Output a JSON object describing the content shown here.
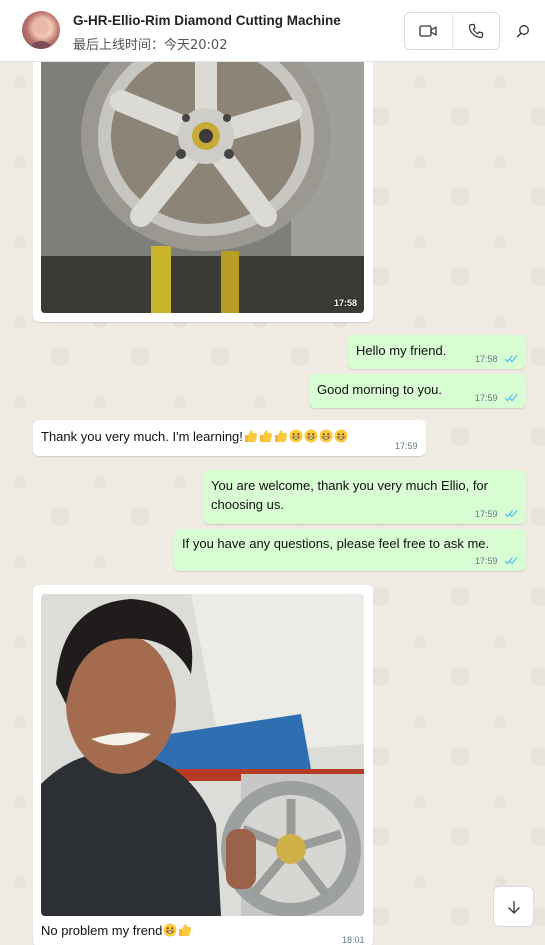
{
  "header": {
    "contact_name": "G-HR-Ellio-Rim Diamond Cutting Machine",
    "last_seen": "最后上线时间：今天20:02",
    "icons": [
      "avatar",
      "video-call-icon",
      "voice-call-icon",
      "search-icon"
    ]
  },
  "messages": [
    {
      "direction": "in",
      "type": "image",
      "caption": "",
      "time": "17:58",
      "image_desc": "wheel-rim-photo"
    },
    {
      "direction": "out",
      "type": "text",
      "text": "Hello my friend.",
      "time": "17:58",
      "status": "read"
    },
    {
      "direction": "out",
      "type": "text",
      "text": "Good morning to you.",
      "time": "17:59",
      "status": "read"
    },
    {
      "direction": "in",
      "type": "text",
      "text": "Thank you very much. I'm learning!",
      "emojis": [
        "thumbs-up",
        "thumbs-up",
        "thumbs-up",
        "grin",
        "grin",
        "grin",
        "grin"
      ],
      "time": "17:59"
    },
    {
      "direction": "out",
      "type": "text",
      "text_line1": "You are welcome, thank you very much Ellio, for",
      "text_line2": "choosing us.",
      "time": "17:59",
      "status": "read"
    },
    {
      "direction": "out",
      "type": "text",
      "text": "If you have any questions, please feel free to ask me.",
      "time": "17:59",
      "status": "read"
    },
    {
      "direction": "in",
      "type": "image",
      "caption": "No problem my frend",
      "emojis": [
        "grin",
        "thumbs-up"
      ],
      "time": "18:01",
      "image_desc": "man-with-wheel-photo"
    }
  ],
  "colors": {
    "outgoing_bubble": "#d9fdd3",
    "incoming_bubble": "#ffffff",
    "chat_background": "#efeae2",
    "read_ticks": "#53bdeb"
  },
  "controls": {
    "scroll_down_icon": "arrow-down-icon"
  }
}
